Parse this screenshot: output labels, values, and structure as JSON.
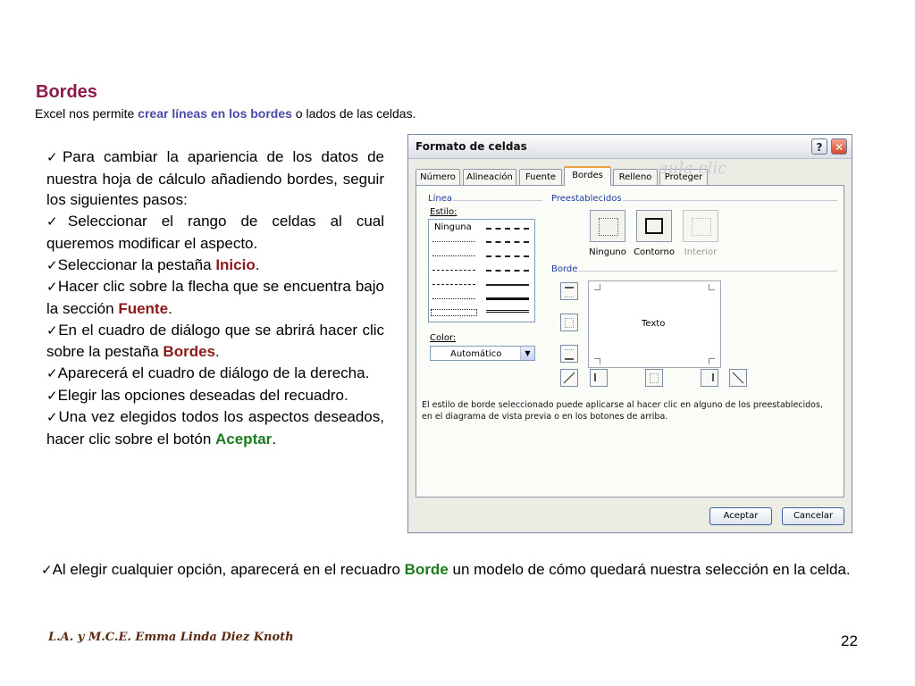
{
  "slide": {
    "title": "Bordes",
    "subtitle_prefix": "Excel nos permite ",
    "subtitle_highlight": "crear líneas en los bordes",
    "subtitle_suffix": " o lados de las celdas.",
    "bullet_check": "✓",
    "bullets": [
      {
        "text": "Para cambiar la apariencia de los datos de nuestra hoja de cálculo añadiendo bordes, seguir los siguientes pasos:"
      },
      {
        "text": "Seleccionar el rango de celdas al cual queremos modificar el aspecto."
      },
      {
        "pre": "Seleccionar la pestaña ",
        "hl": "Inicio",
        "post": "."
      },
      {
        "pre": "Hacer clic sobre la flecha que se encuentra bajo la sección ",
        "hl": "Fuente",
        "post": "."
      },
      {
        "pre": "En el cuadro de diálogo que se abrirá hacer clic sobre la pestaña ",
        "hl": "Bordes",
        "post": "."
      },
      {
        "text": "Aparecerá el cuadro de diálogo de la derecha."
      },
      {
        "text": "Elegir las opciones deseadas del recuadro."
      },
      {
        "pre": "Una vez elegidos todos los aspectos deseados, hacer clic sobre el botón ",
        "hl": "Aceptar",
        "post": "."
      }
    ],
    "bottom_pre": "Al elegir cualquier opción, aparecerá en el recuadro ",
    "bottom_hl": "Borde",
    "bottom_post": " un modelo de cómo quedará nuestra selección en la celda.",
    "author": "L.A. y M.C.E. Emma Linda Diez Knoth",
    "page_number": "22"
  },
  "dialog": {
    "title": "Formato de celdas",
    "help": "?",
    "close": "✕",
    "tabs": [
      "Número",
      "Alineación",
      "Fuente",
      "Bordes",
      "Relleno",
      "Proteger"
    ],
    "active_tab": "Bordes",
    "line_group": "Línea",
    "style_label": "Estilo:",
    "none_style": "Ninguna",
    "color_label": "Color:",
    "color_value": "Automático",
    "presets_group": "Preestablecidos",
    "presets": [
      "Ninguno",
      "Contorno",
      "Interior"
    ],
    "border_group": "Borde",
    "preview_text": "Texto",
    "description": "El estilo de borde seleccionado puede aplicarse al hacer clic en alguno de los preestablecidos, en el diagrama de vista previa o en los botones de arriba.",
    "ok": "Aceptar",
    "cancel": "Cancelar",
    "watermark": "aula clic"
  },
  "colors": {
    "title": "#8b1a4a",
    "highlight_blue": "#4a4aa8",
    "highlight_maroon": "#8b1a1a",
    "highlight_green": "#1f7a1f",
    "author": "#5c2a10"
  }
}
